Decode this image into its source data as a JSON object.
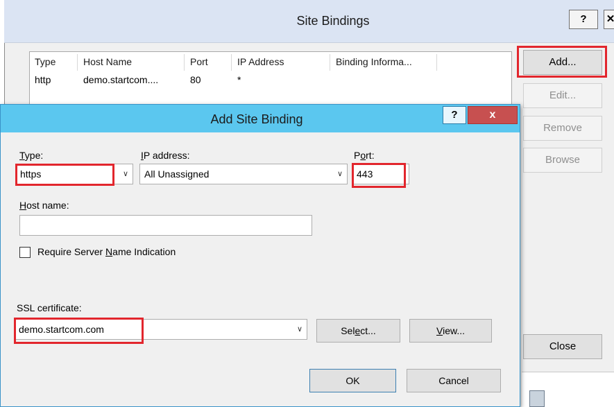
{
  "site_bindings": {
    "title": "Site Bindings",
    "help_label": "?",
    "close_label": "✕",
    "columns": [
      "Type",
      "Host Name",
      "Port",
      "IP Address",
      "Binding Informa..."
    ],
    "rows": [
      {
        "type": "http",
        "host": "demo.startcom....",
        "port": "80",
        "ip": "*",
        "info": ""
      }
    ],
    "buttons": {
      "add": "Add...",
      "edit": "Edit...",
      "remove": "Remove",
      "browse": "Browse",
      "close": "Close"
    }
  },
  "add_site_binding": {
    "title": "Add Site Binding",
    "help_label": "?",
    "close_label": "x",
    "type": {
      "label_first": "T",
      "label_rest": "ype:",
      "value": "https"
    },
    "ip_address": {
      "label_first": "I",
      "label_rest": "P address:",
      "value": "All Unassigned"
    },
    "port": {
      "label_pre": "P",
      "label_first": "o",
      "label_rest": "rt:",
      "value": "443"
    },
    "host_name": {
      "label_first": "H",
      "label_rest": "ost name:",
      "value": ""
    },
    "sni": {
      "label_pre": "Require Server ",
      "label_first": "N",
      "label_rest": "ame Indication",
      "checked": false
    },
    "ssl": {
      "label": "SSL certificate:",
      "value": "demo.startcom.com"
    },
    "select_button": {
      "pre": "Sel",
      "first": "e",
      "rest": "ct..."
    },
    "view_button": {
      "first": "V",
      "rest": "iew..."
    },
    "ok_label": "OK",
    "cancel_label": "Cancel"
  },
  "dropdown_glyph": "∨",
  "highlight_color": "#e2262d"
}
